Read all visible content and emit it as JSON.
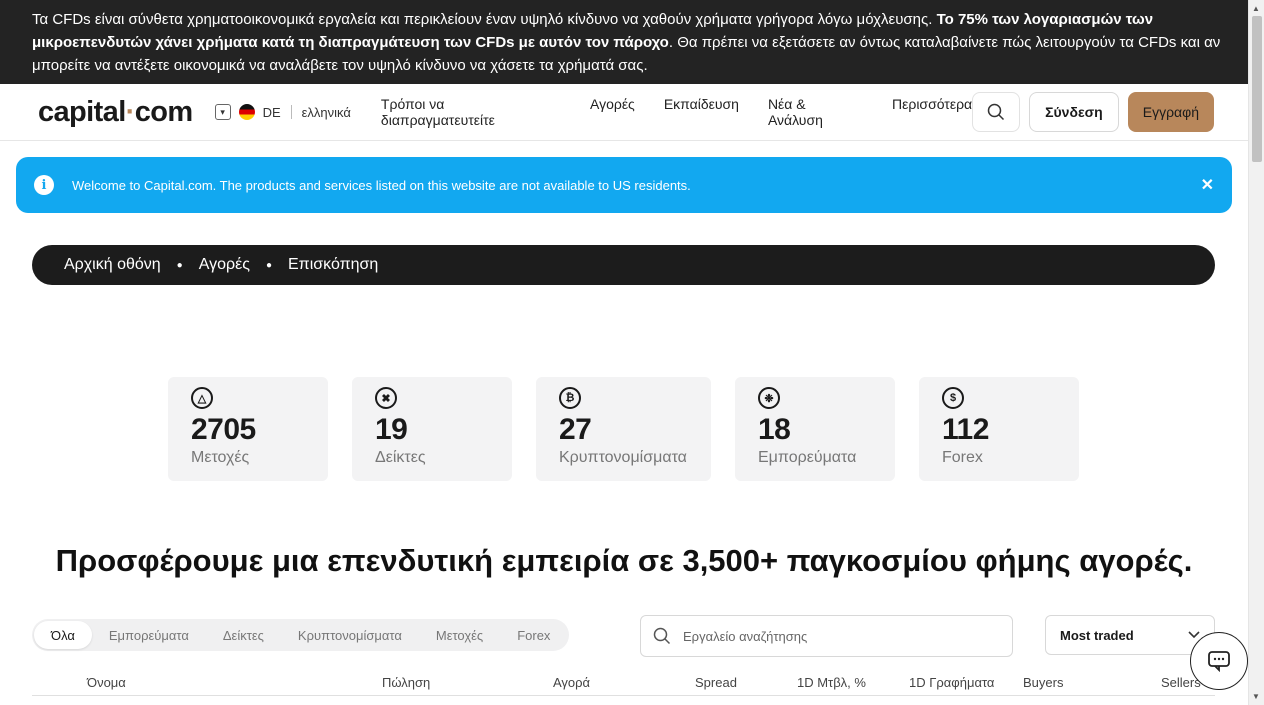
{
  "risk_banner": {
    "text_1": "Τα CFDs είναι σύνθετα χρηματοοικονομικά εργαλεία και περικλείουν έναν υψηλό κίνδυνο να χαθούν χρήματα γρήγορα λόγω μόχλευσης. ",
    "text_bold": "Το 75% των λογαριασμών των μικροεπενδυτών χάνει χρήματα κατά τη διαπραγμάτευση των CFDs με αυτόν τον πάροχο",
    "text_2": ". Θα πρέπει να εξετάσετε αν όντως καταλαβαίνετε πώς λειτουργούν τα CFDs και αν μπορείτε να αντέξετε οικονομικά να αναλάβετε τον υψηλό κίνδυνο να χάσετε τα χρήματά σας."
  },
  "header": {
    "logo_main": "capital",
    "logo_dot": "·",
    "logo_tail": "com",
    "region": "DE",
    "language": "ελληνικά",
    "nav": [
      "Τρόποι να διαπραγματευτείτε",
      "Αγορές",
      "Εκπαίδευση",
      "Νέα & Ανάλυση",
      "Περισσότερα"
    ],
    "login": "Σύνδεση",
    "register": "Εγγραφή"
  },
  "notice": {
    "text": "Welcome to Capital.com. The products and services listed on this website are not available to US residents."
  },
  "breadcrumb": [
    "Αρχική οθόνη",
    "Αγορές",
    "Επισκόπηση"
  ],
  "stats": [
    {
      "icon": "shares-icon",
      "value": "2705",
      "label": "Μετοχές"
    },
    {
      "icon": "indices-icon",
      "value": "19",
      "label": "Δείκτες"
    },
    {
      "icon": "bitcoin-icon",
      "value": "27",
      "label": "Κρυπτονομίσματα"
    },
    {
      "icon": "commodities-icon",
      "value": "18",
      "label": "Εμπορεύματα"
    },
    {
      "icon": "dollar-icon",
      "value": "112",
      "label": "Forex"
    }
  ],
  "headline": "Προσφέρουμε μια επενδυτική εμπειρία σε 3,500+ παγκοσμίου φήμης αγορές.",
  "filters": [
    "Όλα",
    "Εμπορεύματα",
    "Δείκτες",
    "Κρυπτονομίσματα",
    "Μετοχές",
    "Forex"
  ],
  "tool_search": {
    "placeholder": "Εργαλείο αναζήτησης"
  },
  "sort": {
    "selected": "Most traded"
  },
  "table_headers": [
    "Όνομα",
    "Πώληση",
    "Αγορά",
    "Spread",
    "1D Μτβλ, %",
    "1D Γραφήματα",
    "Buyers",
    "Sellers"
  ],
  "colors": {
    "brand": "#b8875b",
    "notice": "#12a8f0",
    "dark": "#232323"
  }
}
